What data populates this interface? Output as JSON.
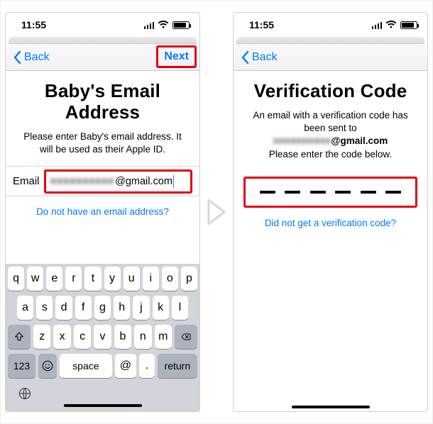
{
  "status": {
    "time": "11:55"
  },
  "left": {
    "nav": {
      "back": "Back",
      "next": "Next"
    },
    "title": "Baby's Email Address",
    "desc": "Please enter Baby's email address. It will be used as their Apple ID.",
    "emailLabel": "Email",
    "emailObscured": "■■■■■■■■■■",
    "emailDomain": "@gmail.com",
    "noEmailLink": "Do not have an email address?",
    "keyboard": {
      "r1": [
        "q",
        "w",
        "e",
        "r",
        "t",
        "y",
        "u",
        "i",
        "o",
        "p"
      ],
      "r2": [
        "a",
        "s",
        "d",
        "f",
        "g",
        "h",
        "j",
        "k",
        "l"
      ],
      "r3": [
        "z",
        "x",
        "c",
        "v",
        "b",
        "n",
        "m"
      ],
      "num": "123",
      "space": "space",
      "at": "@",
      "dot": ".",
      "ret": "return"
    }
  },
  "right": {
    "nav": {
      "back": "Back"
    },
    "title": "Verification Code",
    "descLine1": "An email with a verification code has been sent to",
    "descEmailObscured": "■■■■■■■■■■",
    "descEmailDomain": "@gmail.com",
    "descLine2": "Please enter the code below.",
    "noCodeLink": "Did not get a verification code?",
    "codeLength": 6
  }
}
